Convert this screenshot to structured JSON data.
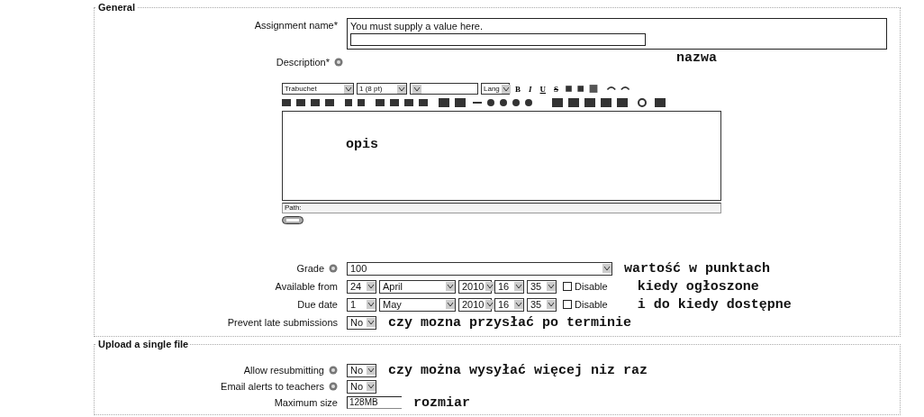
{
  "sections": [
    {
      "legend": "General",
      "fields": [
        {
          "kind": "name",
          "label": "Assignment name*",
          "help": false,
          "error": "You must supply a value here.",
          "note": "nazwa"
        },
        {
          "kind": "editor",
          "label": "Description*",
          "help": true,
          "font": "Trabuchet",
          "size": "1 (8 pt)",
          "lang": "Lang",
          "buttons": [
            "B",
            "I",
            "U",
            "S"
          ],
          "content": "opis",
          "path": "Path:"
        },
        {
          "kind": "select",
          "label": "Grade",
          "help": true,
          "value": "100",
          "wide": true,
          "note": "wartość w punktach"
        },
        {
          "kind": "date",
          "label": "Available from",
          "help": false,
          "day": "24",
          "month": "April",
          "year": "2010",
          "hour": "16",
          "minute": "35",
          "disable_label": "Disable",
          "checked": false,
          "note": "kiedy ogłoszone"
        },
        {
          "kind": "date",
          "label": "Due date",
          "help": false,
          "day": "1",
          "month": "May",
          "year": "2010",
          "hour": "16",
          "minute": "35",
          "disable_label": "Disable",
          "checked": false,
          "note": "i do kiedy dostępne"
        },
        {
          "kind": "select",
          "label": "Prevent late submissions",
          "help": false,
          "value": "No",
          "wide": false,
          "note": "czy mozna przysłać po terminie"
        }
      ]
    },
    {
      "legend": "Upload a single file",
      "fields": [
        {
          "kind": "select",
          "label": "Allow resubmitting",
          "help": true,
          "value": "No",
          "wide": false,
          "note": "czy można wysyłać więcej niz raz"
        },
        {
          "kind": "select",
          "label": "Email alerts to teachers",
          "help": true,
          "value": "No",
          "wide": false
        },
        {
          "kind": "text",
          "label": "Maximum size",
          "help": false,
          "value": "128MB",
          "note": "rozmiar"
        }
      ]
    }
  ]
}
